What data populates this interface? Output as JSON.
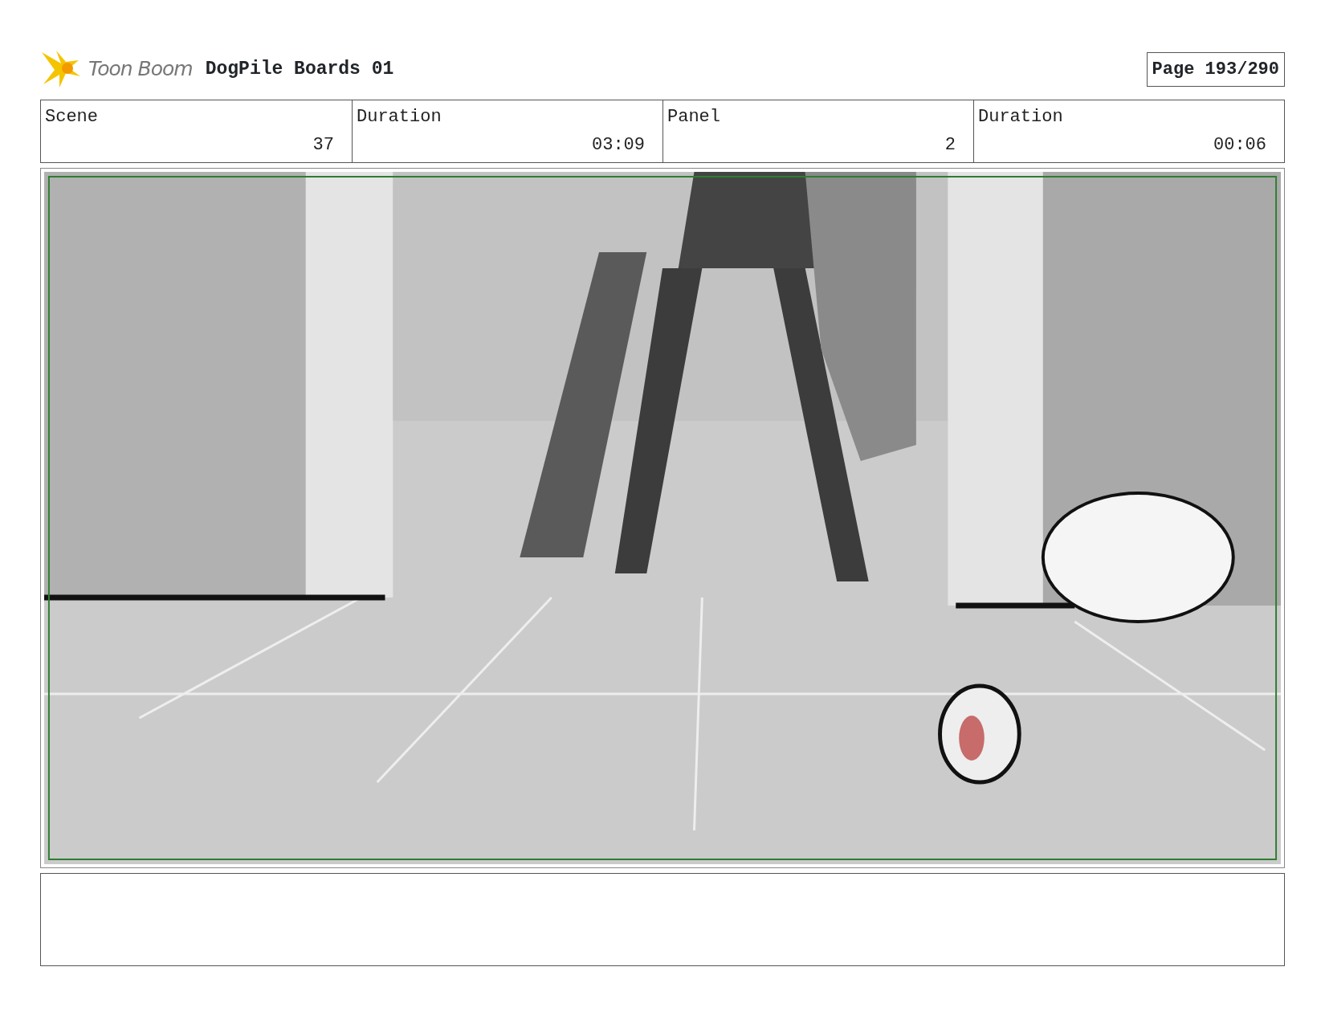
{
  "header": {
    "logo_text": "Toon Boom",
    "title": "DogPile Boards 01",
    "page": "Page 193/290"
  },
  "fields": [
    {
      "label": "Scene",
      "value": "37"
    },
    {
      "label": "Duration",
      "value": "03:09"
    },
    {
      "label": "Panel",
      "value": "2"
    },
    {
      "label": "Duration",
      "value": "00:06"
    }
  ]
}
